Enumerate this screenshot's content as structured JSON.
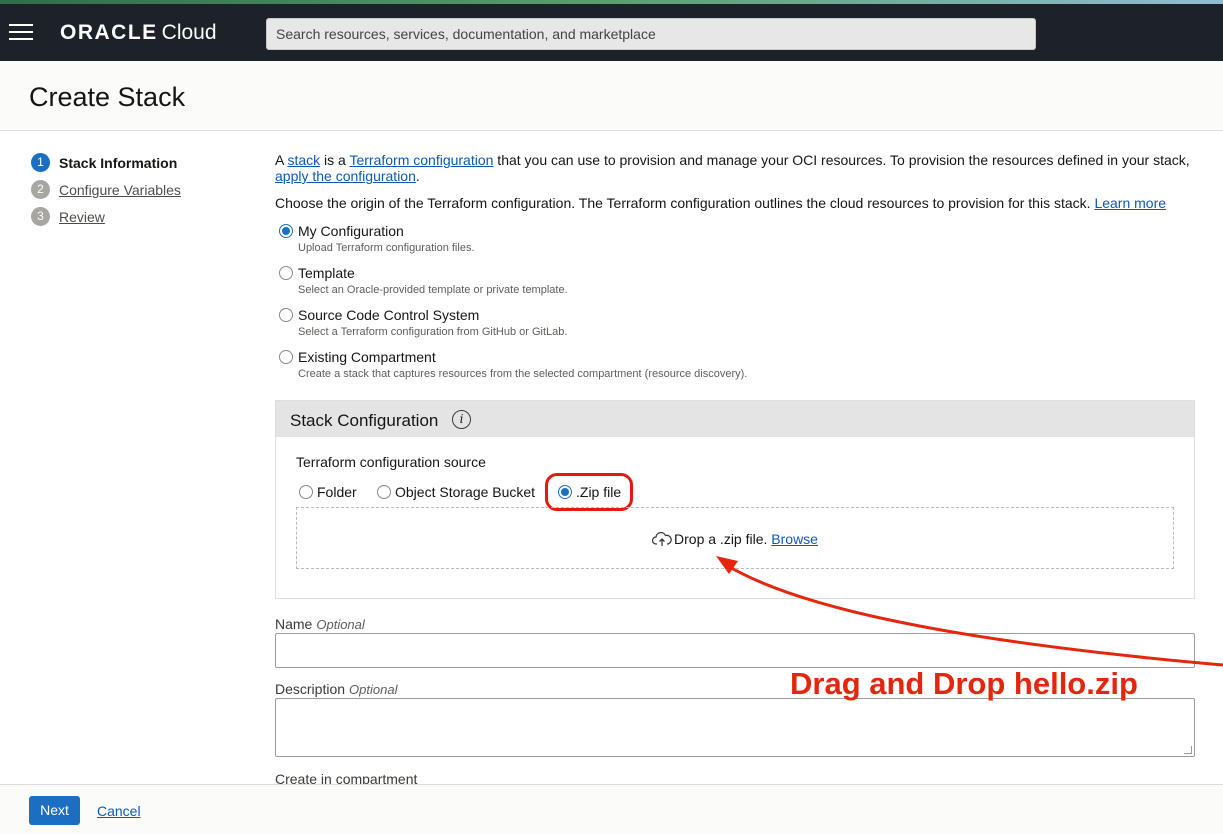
{
  "header": {
    "menu_icon": "hamburger-menu-icon",
    "logo_brand": "ORACLE",
    "logo_product": "Cloud",
    "search_placeholder": "Search resources, services, documentation, and marketplace"
  },
  "page": {
    "title": "Create Stack"
  },
  "steps": [
    {
      "num": "1",
      "label": "Stack Information",
      "active": true
    },
    {
      "num": "2",
      "label": "Configure Variables",
      "active": false
    },
    {
      "num": "3",
      "label": "Review",
      "active": false
    }
  ],
  "intro": {
    "p1_a": "A ",
    "stack_link": "stack",
    "p1_b": " is a ",
    "terraform_link": "Terraform configuration",
    "p1_c": " that you can use to provision and manage your OCI resources. To provision the resources defined in your stack, ",
    "apply_link": "apply the configuration",
    "p1_d": ".",
    "p2": "Choose the origin of the Terraform configuration. The Terraform configuration outlines the cloud resources to provision for this stack. ",
    "learn_more": "Learn more"
  },
  "origins": [
    {
      "label": "My Configuration",
      "desc": "Upload Terraform configuration files.",
      "checked": true
    },
    {
      "label": "Template",
      "desc": "Select an Oracle-provided template or private template.",
      "checked": false
    },
    {
      "label": "Source Code Control System",
      "desc": "Select a Terraform configuration from GitHub or GitLab.",
      "checked": false
    },
    {
      "label": "Existing Compartment",
      "desc": "Create a stack that captures resources from the selected compartment (resource discovery).",
      "checked": false
    }
  ],
  "stack_config": {
    "title": "Stack Configuration",
    "info_icon": "info-icon",
    "source_label": "Terraform configuration source",
    "sources": [
      {
        "label": "Folder",
        "checked": false
      },
      {
        "label": "Object Storage Bucket",
        "checked": false
      },
      {
        "label": ".Zip file",
        "checked": true
      }
    ],
    "dropzone_text": "Drop a .zip file. ",
    "browse_link": "Browse",
    "upload_icon": "cloud-upload-icon"
  },
  "fields": {
    "name_label": "Name",
    "name_optional": "Optional",
    "name_value": "",
    "description_label": "Description",
    "description_optional": "Optional",
    "description_value": "",
    "compartment_label": "Create in compartment"
  },
  "annotation": {
    "text": "Drag and Drop hello.zip",
    "color": "#e5260d"
  },
  "footer": {
    "next_label": "Next",
    "cancel_label": "Cancel"
  },
  "colors": {
    "accent": "#1b6ec2",
    "topbar": "#1c2228",
    "link": "#0d58b6"
  }
}
